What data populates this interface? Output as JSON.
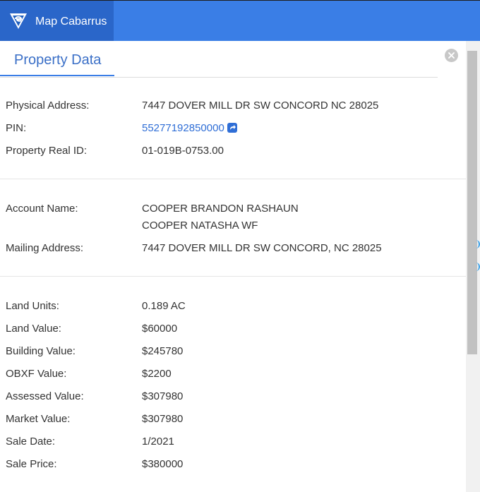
{
  "header": {
    "app_title": "Map Cabarrus",
    "colors": {
      "bar": "#3a7ee6",
      "brand": "#2a66c9"
    },
    "logo_icon": "cabarrus-logo-icon"
  },
  "panel": {
    "tab_label": "Property Data",
    "close_icon": "close-icon"
  },
  "property": {
    "physical_address_label": "Physical Address:",
    "physical_address": "7447 DOVER MILL DR SW CONCORD NC 28025",
    "pin_label": "PIN:",
    "pin": "55277192850000",
    "pin_link_icon": "external-link-icon",
    "real_id_label": "Property Real ID:",
    "real_id": "01-019B-0753.00"
  },
  "owner": {
    "account_name_label": "Account Name:",
    "account_names": [
      "COOPER BRANDON RASHAUN",
      "COOPER NATASHA WF"
    ],
    "mailing_address_label": "Mailing Address:",
    "mailing_address": "7447 DOVER MILL DR SW CONCORD, NC 28025"
  },
  "valuation": [
    {
      "label": "Land Units:",
      "value": "0.189 AC"
    },
    {
      "label": "Land Value:",
      "value": "$60000"
    },
    {
      "label": "Building Value:",
      "value": "$245780"
    },
    {
      "label": "OBXF Value:",
      "value": "$2200"
    },
    {
      "label": "Assessed Value:",
      "value": "$307980"
    },
    {
      "label": "Market Value:",
      "value": "$307980"
    },
    {
      "label": "Sale Date:",
      "value": "1/2021"
    },
    {
      "label": "Sale Price:",
      "value": "$380000"
    }
  ]
}
